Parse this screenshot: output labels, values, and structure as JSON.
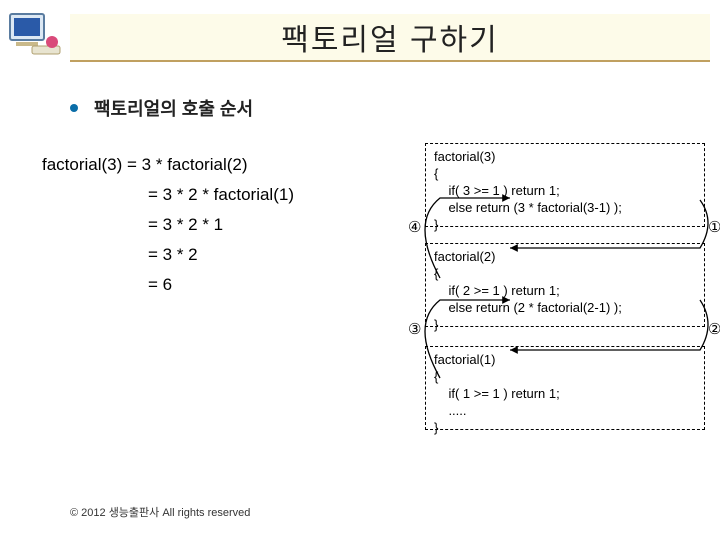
{
  "title": "팩토리얼 구하기",
  "bullet": "팩토리얼의 호출 순서",
  "derivation": {
    "l1": "factorial(3) = 3 * factorial(2)",
    "l2": "= 3 * 2 * factorial(1)",
    "l3": "= 3 * 2 * 1",
    "l4": "= 3 * 2",
    "l5": "= 6"
  },
  "code": {
    "box1": {
      "l1": "factorial(3)",
      "l2": "{",
      "l3": "    if( 3 >= 1 ) return 1;",
      "l4": "    else return (3 * factorial(3-1) );",
      "l5": "}"
    },
    "box2": {
      "l1": "factorial(2)",
      "l2": "{",
      "l3": "    if( 2 >= 1 ) return 1;",
      "l4": "    else return (2 * factorial(2-1) );",
      "l5": "}"
    },
    "box3": {
      "l1": "factorial(1)",
      "l2": "{",
      "l3": "    if( 1 >= 1 ) return 1;",
      "l4": "    .....",
      "l5": "}"
    }
  },
  "nums": {
    "n1": "①",
    "n2": "②",
    "n3": "③",
    "n4": "④"
  },
  "copyright": "© 2012 생능출판사 All rights reserved"
}
